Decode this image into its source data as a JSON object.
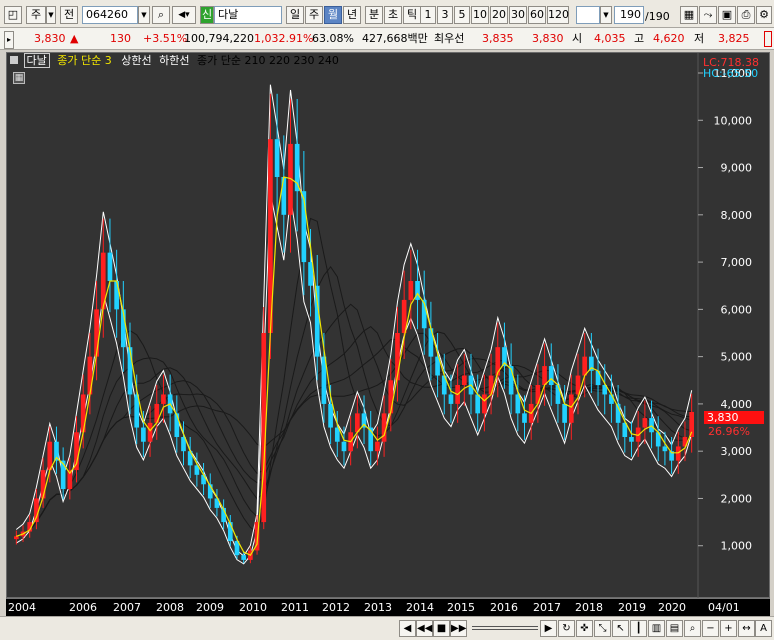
{
  "toolbar": {
    "mode_label": "주",
    "jeon_label": "전",
    "code_value": "064260",
    "sin_label": "신",
    "name_value": "다날",
    "period_tabs": [
      "일",
      "주",
      "월",
      "년",
      "분",
      "초",
      "틱"
    ],
    "selected_period": "월",
    "numbers": [
      "1",
      "3",
      "5",
      "10",
      "20",
      "30",
      "60",
      "120"
    ],
    "count_value": "190",
    "count_total": "/190"
  },
  "quote": {
    "price": "3,830",
    "arrow": "▲",
    "change": "130",
    "change_pct": "+3.51%",
    "volume": "100,794,220",
    "volume_pct": "1,032.91%",
    "pct2": "63.08%",
    "amount": "427,668백만",
    "best_label": "최우선",
    "best_ask": "3,835",
    "best_bid": "3,830",
    "open_label": "시",
    "open": "4,035",
    "high_label": "고",
    "high": "4,620",
    "low_label": "저",
    "low": "3,825"
  },
  "legend": {
    "name_tag": "다날",
    "ma_label": "종가 단순 3",
    "upper_label": "상한선",
    "lower_label": "하한선",
    "ma2_label": "종가 단순 210 220 230 240"
  },
  "readouts": {
    "lc": "LC:718.38",
    "hc": "HC:-65.50",
    "last_price": "3,830",
    "last_pct": "26.96%"
  },
  "colors": {
    "up": "#ff2020",
    "down": "#21d1ff",
    "ma3": "#f2e600",
    "band": "#ffffff",
    "ma_long": "#000000",
    "background": "#333333"
  },
  "chart_data": {
    "type": "candlestick",
    "ylim": [
      0,
      11000
    ],
    "y_ticks": [
      "1,000",
      "2,000",
      "3,000",
      "4,000",
      "5,000",
      "6,000",
      "7,000",
      "8,000",
      "9,000",
      "10,000",
      "11,000"
    ],
    "x_ticks": [
      "2004",
      "2006",
      "2007",
      "2008",
      "2009",
      "2010",
      "2011",
      "2012",
      "2013",
      "2014",
      "2015",
      "2016",
      "2017",
      "2018",
      "2019",
      "2020",
      "04/01"
    ],
    "series": [
      {
        "name": "close",
        "values": [
          1200,
          1300,
          1500,
          2000,
          2600,
          3200,
          2800,
          2200,
          2600,
          3400,
          4200,
          5000,
          6000,
          7200,
          6600,
          6000,
          5200,
          4200,
          3500,
          3200,
          3600,
          4000,
          4200,
          3800,
          3300,
          3000,
          2700,
          2500,
          2300,
          2000,
          1800,
          1500,
          1100,
          800,
          700,
          900,
          1500,
          5500,
          9600,
          8800,
          8000,
          9500,
          8500,
          7000,
          6500,
          5000,
          4000,
          3500,
          3200,
          3000,
          3400,
          3800,
          3500,
          3000,
          3200,
          3800,
          4500,
          5500,
          6200,
          6600,
          6200,
          5600,
          5000,
          4600,
          4200,
          4000,
          4400,
          4600,
          4200,
          3800,
          4200,
          4600,
          5200,
          4800,
          4200,
          3800,
          3600,
          4000,
          4400,
          4800,
          4400,
          4000,
          3600,
          4200,
          4600,
          5000,
          4700,
          4400,
          4200,
          4000,
          3600,
          3300,
          3200,
          3500,
          3700,
          3400,
          3100,
          3000,
          2800,
          3100,
          3300,
          3830
        ]
      }
    ],
    "time_range": [
      "2004",
      "2020"
    ]
  }
}
